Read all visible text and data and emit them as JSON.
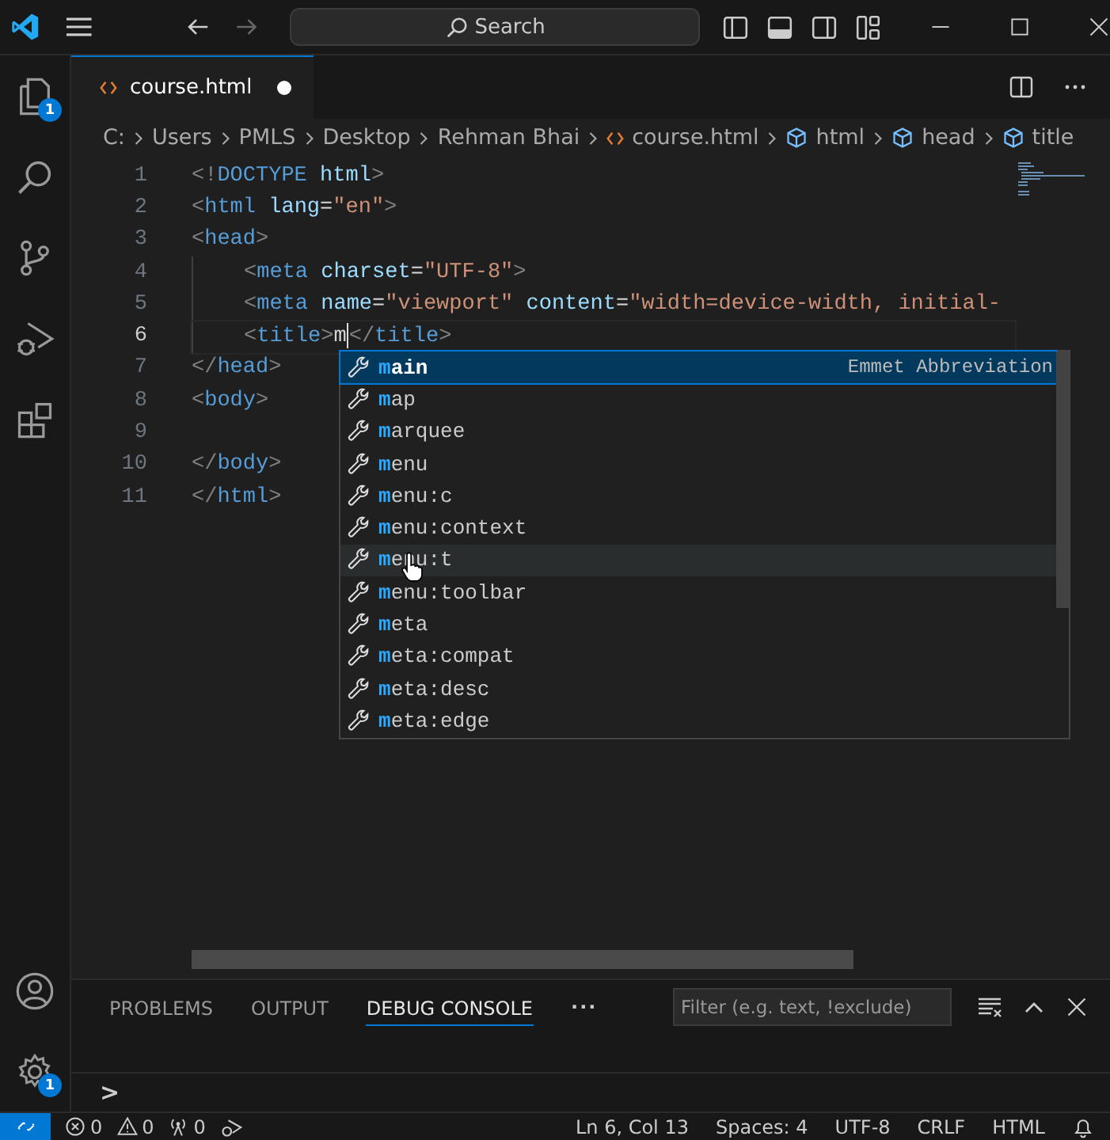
{
  "title_bar": {
    "search": "Search"
  },
  "activity_bar": [
    {
      "kind": "explorer",
      "badge": "1",
      "selected": false
    },
    {
      "kind": "search",
      "selected": false
    },
    {
      "kind": "source-control",
      "selected": false
    },
    {
      "kind": "run",
      "selected": false
    },
    {
      "kind": "extensions",
      "selected": false
    }
  ],
  "account_badges": {
    "settings": "1"
  },
  "tabs": [
    {
      "label": "course.html",
      "selected": true,
      "modified": true
    }
  ],
  "breadcrumbs": [
    {
      "kind": "folder",
      "label": "C:"
    },
    {
      "kind": "folder",
      "label": "Users"
    },
    {
      "kind": "folder",
      "label": "PMLS"
    },
    {
      "kind": "folder",
      "label": "Desktop"
    },
    {
      "kind": "folder",
      "label": "Rehman Bhai"
    },
    {
      "kind": "file",
      "label": "course.html"
    },
    {
      "kind": "symbol",
      "label": "html"
    },
    {
      "kind": "symbol",
      "label": "head"
    },
    {
      "kind": "symbol",
      "label": "title"
    }
  ],
  "code_lines": [
    {
      "number": "1",
      "current": false,
      "guide": false,
      "tokens": [
        {
          "kind": "punct",
          "text": "<!"
        },
        {
          "kind": "tag",
          "text": "DOCTYPE"
        },
        {
          "kind": "attr",
          "text": " html"
        },
        {
          "kind": "punct",
          "text": ">"
        }
      ]
    },
    {
      "number": "2",
      "current": false,
      "guide": false,
      "tokens": [
        {
          "kind": "punct",
          "text": "<"
        },
        {
          "kind": "tag",
          "text": "html"
        },
        {
          "kind": "attr",
          "text": " lang"
        },
        {
          "kind": "text",
          "text": "="
        },
        {
          "kind": "str",
          "text": "\"en\""
        },
        {
          "kind": "punct",
          "text": ">"
        }
      ]
    },
    {
      "number": "3",
      "current": false,
      "guide": false,
      "tokens": [
        {
          "kind": "punct",
          "text": "<"
        },
        {
          "kind": "tag",
          "text": "head"
        },
        {
          "kind": "punct",
          "text": ">"
        }
      ]
    },
    {
      "number": "4",
      "current": false,
      "guide": true,
      "tokens": [
        {
          "kind": "punct",
          "text": "<"
        },
        {
          "kind": "tag",
          "text": "meta"
        },
        {
          "kind": "attr",
          "text": " charset"
        },
        {
          "kind": "text",
          "text": "="
        },
        {
          "kind": "str",
          "text": "\"UTF-8\""
        },
        {
          "kind": "punct",
          "text": ">"
        }
      ]
    },
    {
      "number": "5",
      "current": false,
      "guide": true,
      "tokens": [
        {
          "kind": "punct",
          "text": "<"
        },
        {
          "kind": "tag",
          "text": "meta"
        },
        {
          "kind": "attr",
          "text": " name"
        },
        {
          "kind": "text",
          "text": "="
        },
        {
          "kind": "str",
          "text": "\"viewport\""
        },
        {
          "kind": "attr",
          "text": " content"
        },
        {
          "kind": "text",
          "text": "="
        },
        {
          "kind": "str",
          "text": "\"width=device-width, initial-"
        }
      ]
    },
    {
      "number": "6",
      "current": true,
      "guide": true,
      "tokens": [
        {
          "kind": "punct",
          "text": "<"
        },
        {
          "kind": "tag",
          "text": "title"
        },
        {
          "kind": "punct",
          "text": ">"
        },
        {
          "kind": "text",
          "text": "m"
        },
        {
          "kind": "cursor"
        },
        {
          "kind": "punct",
          "text": "</"
        },
        {
          "kind": "tag",
          "text": "title"
        },
        {
          "kind": "punct",
          "text": ">"
        }
      ]
    },
    {
      "number": "7",
      "current": false,
      "guide": false,
      "tokens": [
        {
          "kind": "punct",
          "text": "</"
        },
        {
          "kind": "tag",
          "text": "head"
        },
        {
          "kind": "punct",
          "text": ">"
        }
      ]
    },
    {
      "number": "8",
      "current": false,
      "guide": false,
      "tokens": [
        {
          "kind": "punct",
          "text": "<"
        },
        {
          "kind": "tag",
          "text": "body"
        },
        {
          "kind": "punct",
          "text": ">"
        }
      ]
    },
    {
      "number": "9",
      "current": false,
      "guide": false
    },
    {
      "number": "10",
      "current": false,
      "guide": false,
      "tokens": [
        {
          "kind": "punct",
          "text": "</"
        },
        {
          "kind": "tag",
          "text": "body"
        },
        {
          "kind": "punct",
          "text": ">"
        }
      ]
    },
    {
      "number": "11",
      "current": false,
      "guide": false,
      "tokens": [
        {
          "kind": "punct",
          "text": "</"
        },
        {
          "kind": "tag",
          "text": "html"
        },
        {
          "kind": "punct",
          "text": ">"
        }
      ]
    }
  ],
  "suggestions": {
    "detail": "Emmet Abbreviation",
    "items": [
      {
        "match": "m",
        "rest": "ain",
        "selected": true,
        "hovered": false
      },
      {
        "match": "m",
        "rest": "ap",
        "selected": false,
        "hovered": false
      },
      {
        "match": "m",
        "rest": "arquee",
        "selected": false,
        "hovered": false
      },
      {
        "match": "m",
        "rest": "enu",
        "selected": false,
        "hovered": false
      },
      {
        "match": "m",
        "rest": "enu:c",
        "selected": false,
        "hovered": false
      },
      {
        "match": "m",
        "rest": "enu:context",
        "selected": false,
        "hovered": false
      },
      {
        "match": "m",
        "rest": "enu:t",
        "selected": false,
        "hovered": true
      },
      {
        "match": "m",
        "rest": "enu:toolbar",
        "selected": false,
        "hovered": false
      },
      {
        "match": "m",
        "rest": "eta",
        "selected": false,
        "hovered": false
      },
      {
        "match": "m",
        "rest": "eta:compat",
        "selected": false,
        "hovered": false
      },
      {
        "match": "m",
        "rest": "eta:desc",
        "selected": false,
        "hovered": false
      },
      {
        "match": "m",
        "rest": "eta:edge",
        "selected": false,
        "hovered": false
      }
    ]
  },
  "panel": {
    "tabs": [
      {
        "label": "PROBLEMS",
        "selected": false
      },
      {
        "label": "OUTPUT",
        "selected": false
      },
      {
        "label": "DEBUG CONSOLE",
        "selected": true
      }
    ],
    "more": "···",
    "filter_placeholder": "Filter (e.g. text, !exclude)",
    "prompt": ">"
  },
  "status_bar": {
    "left": [
      {
        "kind": "errors",
        "text": "0"
      },
      {
        "kind": "warnings",
        "text": "0"
      },
      {
        "kind": "ports",
        "text": "0"
      }
    ],
    "right": [
      "Ln 6, Col 13",
      "Spaces: 4",
      "UTF-8",
      "CRLF",
      "HTML"
    ]
  }
}
